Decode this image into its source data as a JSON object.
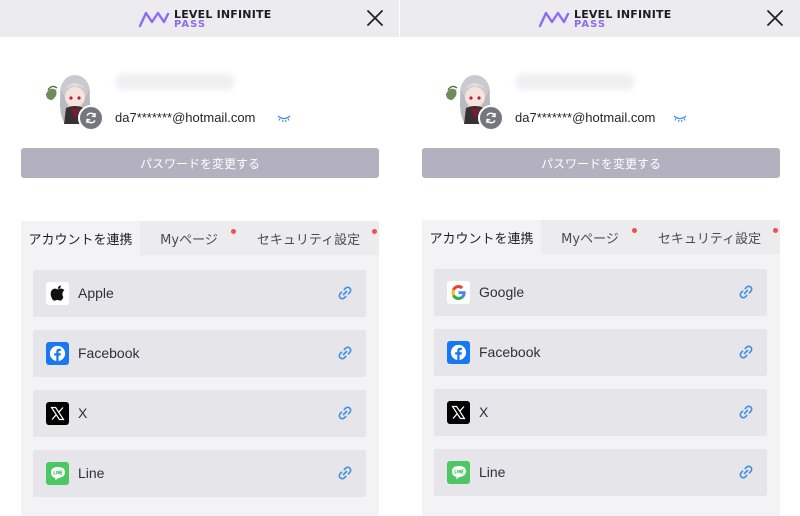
{
  "brand": {
    "line1": "LEVEL INFINITE",
    "line2": "PASS",
    "accent": "#8c6cf0"
  },
  "colors": {
    "header_bg": "#ececf0",
    "button_bg": "#b3b0c0",
    "tab_dot": "#f0504a",
    "link_icon": "#3f8fe0"
  },
  "panels": [
    {
      "email": "da7*******@hotmail.com",
      "change_password": "パスワードを変更する",
      "tabs": [
        {
          "label": "アカウントを連携",
          "active": true,
          "badge": false
        },
        {
          "label": "Myページ",
          "active": false,
          "badge": true
        },
        {
          "label": "セキュリティ設定",
          "active": false,
          "badge": true
        }
      ],
      "accounts": [
        {
          "label": "Apple",
          "icon": "apple-icon"
        },
        {
          "label": "Facebook",
          "icon": "facebook-icon"
        },
        {
          "label": "X",
          "icon": "x-icon"
        },
        {
          "label": "Line",
          "icon": "line-icon"
        }
      ]
    },
    {
      "email": "da7*******@hotmail.com",
      "change_password": "パスワードを変更する",
      "tabs": [
        {
          "label": "アカウントを連携",
          "active": true,
          "badge": false
        },
        {
          "label": "Myページ",
          "active": false,
          "badge": true
        },
        {
          "label": "セキュリティ設定",
          "active": false,
          "badge": true
        }
      ],
      "accounts": [
        {
          "label": "Google",
          "icon": "google-icon"
        },
        {
          "label": "Facebook",
          "icon": "facebook-icon"
        },
        {
          "label": "X",
          "icon": "x-icon"
        },
        {
          "label": "Line",
          "icon": "line-icon"
        }
      ]
    }
  ]
}
